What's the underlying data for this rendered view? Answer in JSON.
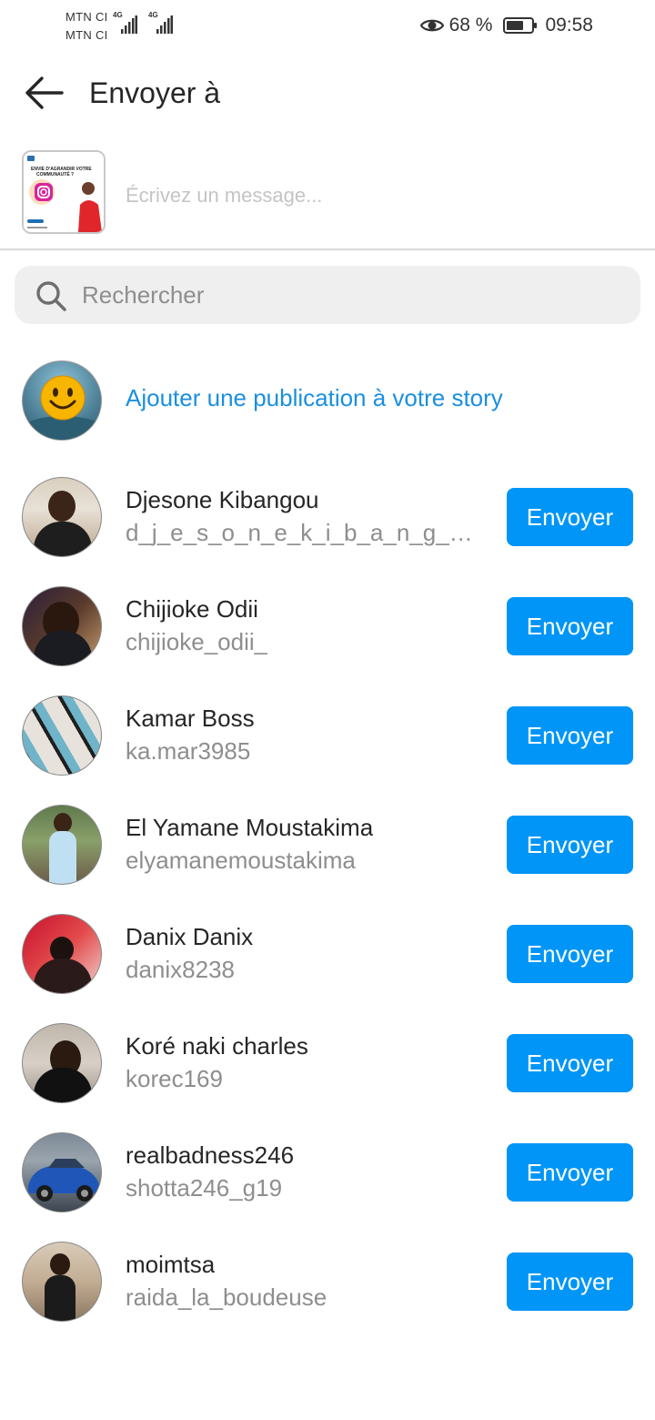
{
  "status_bar": {
    "carrier_1": "MTN CI",
    "carrier_2": "MTN CI",
    "network_1": "4G",
    "network_2": "4G",
    "battery_percent": "68 %",
    "battery_level": 0.68,
    "time": "09:58",
    "icons": [
      "signal-icon",
      "eye-icon",
      "battery-icon"
    ]
  },
  "header": {
    "back_icon": "arrow-left-icon",
    "title": "Envoyer à"
  },
  "compose": {
    "thumbnail_text": "ENVIE D'AGRANDIR VOTRE COMMUNAUTÉ ?",
    "message_placeholder": "Écrivez un message..."
  },
  "search": {
    "icon": "search-icon",
    "placeholder": "Rechercher"
  },
  "story": {
    "label": "Ajouter une publication à votre story"
  },
  "colors": {
    "accent": "#0095f6",
    "story_link": "#1a8fe0",
    "secondary_text": "#8e8e8e",
    "search_bg": "#efefef"
  },
  "contacts": [
    {
      "name": "Djesone Kibangou",
      "username": "d_j_e_s_o_n_e_k_i_b_a_n_g_o_u",
      "button": "Envoyer"
    },
    {
      "name": "Chijioke Odii",
      "username": "chijioke_odii_",
      "button": "Envoyer"
    },
    {
      "name": "Kamar Boss",
      "username": "ka.mar3985",
      "button": "Envoyer"
    },
    {
      "name": "El Yamane Moustakima",
      "username": "elyamanemoustakima",
      "button": "Envoyer"
    },
    {
      "name": "Danix Danix",
      "username": "danix8238",
      "button": "Envoyer"
    },
    {
      "name": "Koré naki charles",
      "username": "korec169",
      "button": "Envoyer"
    },
    {
      "name": "realbadness246",
      "username": "shotta246_g19",
      "button": "Envoyer"
    },
    {
      "name": "moimtsa",
      "username": "raida_la_boudeuse",
      "button": "Envoyer"
    }
  ]
}
